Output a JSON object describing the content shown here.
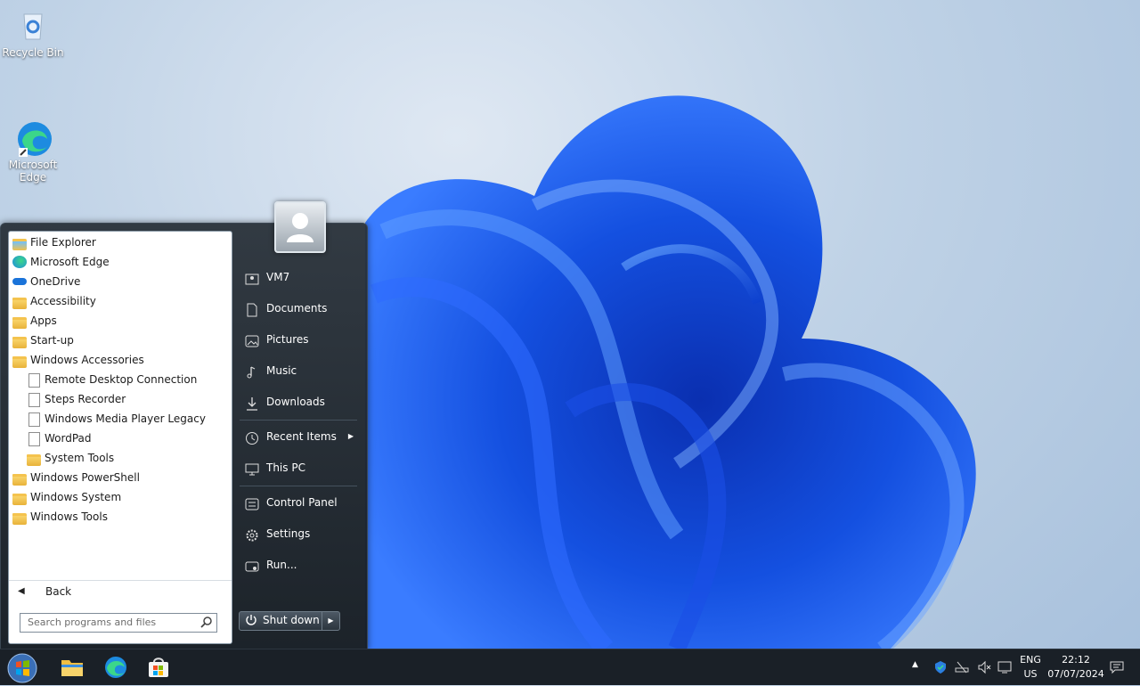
{
  "desktop": {
    "icons": [
      {
        "label": "Recycle Bin",
        "icon": "recycle-bin-icon"
      },
      {
        "label": "Microsoft\nEdge",
        "icon": "edge-icon"
      }
    ]
  },
  "start_menu": {
    "programs": [
      {
        "label": "File Explorer",
        "icon": "file-explorer-icon"
      },
      {
        "label": "Microsoft Edge",
        "icon": "edge-icon"
      },
      {
        "label": "OneDrive",
        "icon": "onedrive-icon"
      },
      {
        "label": "Accessibility",
        "icon": "folder-icon"
      },
      {
        "label": "Apps",
        "icon": "apps-icon"
      },
      {
        "label": "Start-up",
        "icon": "folder-icon"
      },
      {
        "label": "Windows Accessories",
        "icon": "folder-icon"
      },
      {
        "label": "Remote Desktop Connection",
        "icon": "shortcut-icon"
      },
      {
        "label": "Steps Recorder",
        "icon": "shortcut-icon"
      },
      {
        "label": "Windows Media Player Legacy",
        "icon": "shortcut-icon"
      },
      {
        "label": "WordPad",
        "icon": "shortcut-icon"
      },
      {
        "label": "System Tools",
        "icon": "folder-icon"
      },
      {
        "label": "Windows PowerShell",
        "icon": "folder-icon"
      },
      {
        "label": "Windows System",
        "icon": "folder-icon"
      },
      {
        "label": "Windows Tools",
        "icon": "folder-icon"
      }
    ],
    "back_label": "Back",
    "search_placeholder": "Search programs and files",
    "right_items": [
      {
        "label": "VM7",
        "icon": "user-folder-icon"
      },
      {
        "label": "Documents",
        "icon": "document-icon"
      },
      {
        "label": "Pictures",
        "icon": "picture-icon"
      },
      {
        "label": "Music",
        "icon": "music-icon"
      },
      {
        "label": "Downloads",
        "icon": "download-icon"
      },
      {
        "label": "Recent Items",
        "icon": "clock-icon"
      },
      {
        "label": "This PC",
        "icon": "computer-icon"
      },
      {
        "label": "Control Panel",
        "icon": "control-panel-icon"
      },
      {
        "label": "Settings",
        "icon": "gear-icon"
      },
      {
        "label": "Run...",
        "icon": "run-icon"
      }
    ],
    "shutdown_label": "Shut down"
  },
  "taskbar": {
    "pinned": [
      "start-orb-icon",
      "file-explorer-icon",
      "edge-icon",
      "store-icon"
    ],
    "language": {
      "line1": "ENG",
      "line2": "US"
    },
    "clock": {
      "time": "22:12",
      "date": "07/07/2024"
    }
  }
}
